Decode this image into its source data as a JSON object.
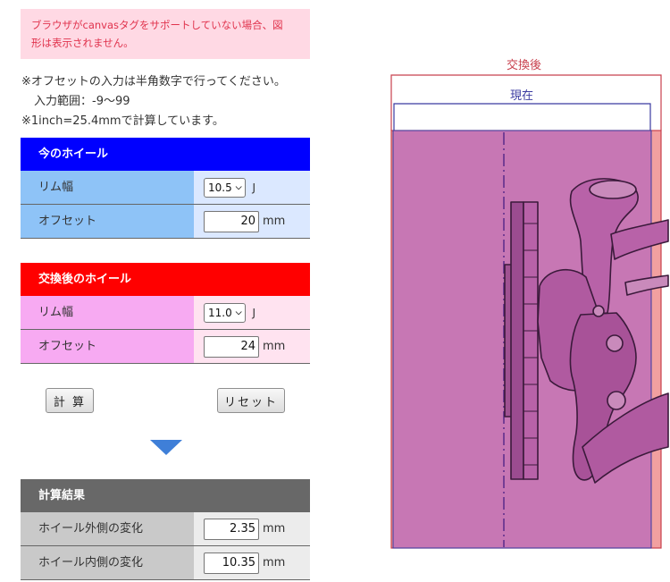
{
  "notice": {
    "line1": "ブラウザがcanvasタグをサポートしていない場合、図",
    "line2": "形は表示されません。"
  },
  "notes": [
    "※オフセットの入力は半角数字で行ってください。",
    "入力範囲：-9〜99",
    "※1inch=25.4mmで計算しています。"
  ],
  "current_wheel": {
    "title": "今のホイール",
    "rim_label": "リム幅",
    "rim_value": "10.5",
    "rim_unit": "J",
    "offset_label": "オフセット",
    "offset_value": "20",
    "offset_unit": "mm"
  },
  "new_wheel": {
    "title": "交換後のホイール",
    "rim_label": "リム幅",
    "rim_value": "11.0",
    "rim_unit": "J",
    "offset_label": "オフセット",
    "offset_value": "24",
    "offset_unit": "mm"
  },
  "buttons": {
    "calc": "計 算",
    "reset": "リセット"
  },
  "result": {
    "title": "計算結果",
    "outer_label": "ホイール外側の変化",
    "outer_value": "2.35",
    "outer_unit": "mm",
    "inner_label": "ホイール内側の変化",
    "inner_value": "10.35",
    "inner_unit": "mm"
  },
  "diagram": {
    "after_label": "交換後",
    "current_label": "現在",
    "after_color": "#c8404d",
    "current_color": "#3a3aa0",
    "wheel_fill": "#c777b4"
  },
  "colors": {
    "current_head": "#0000ff",
    "current_label_bg": "#8ec3f7",
    "current_value_bg": "#dbe8ff",
    "new_head": "#ff0000",
    "new_label_bg": "#f7aaf2",
    "new_value_bg": "#ffe3f0",
    "result_head": "#686868",
    "result_label_bg": "#c9c9c9",
    "result_value_bg": "#ececec",
    "arrow": "#3f7fd8"
  }
}
